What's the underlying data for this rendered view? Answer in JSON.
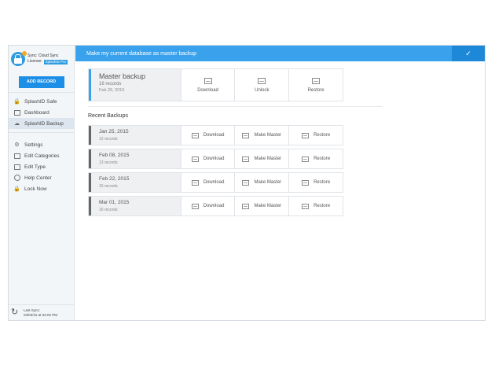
{
  "sidebar": {
    "app_name": "Sync: Cloud Sync",
    "license_label": "License:",
    "license_badge": "SplashID Pro",
    "add_record": "ADD RECORD",
    "nav_primary": [
      {
        "label": "SplashID Safe",
        "icon": "lock-icon",
        "active": false
      },
      {
        "label": "Dashboard",
        "icon": "dashboard-icon",
        "active": false
      },
      {
        "label": "SplashID Backup",
        "icon": "cloud-icon",
        "active": true
      }
    ],
    "nav_secondary": [
      {
        "label": "Settings",
        "icon": "gear-icon"
      },
      {
        "label": "Edit Categories",
        "icon": "folder-icon"
      },
      {
        "label": "Edit Type",
        "icon": "folder-icon"
      },
      {
        "label": "Help Center",
        "icon": "info-icon"
      },
      {
        "label": "Lock Now",
        "icon": "lock-icon"
      }
    ],
    "footer": {
      "last_sync_label": "Last Sync:",
      "last_sync_time": "03/02/15 at 02:02 PM"
    }
  },
  "topbar": {
    "message": "Make my current database as master backup",
    "confirm_icon": "check-icon"
  },
  "master": {
    "title": "Master backup",
    "records": "16 records",
    "date": "Feb 26, 2015",
    "actions": [
      "Download",
      "Unlock",
      "Restore"
    ]
  },
  "recent": {
    "title": "Recent Backups",
    "actions": [
      "Download",
      "Make Master",
      "Restore"
    ],
    "rows": [
      {
        "date": "Jan 25, 2015",
        "records": "12 records"
      },
      {
        "date": "Feb 08, 2015",
        "records": "13 records"
      },
      {
        "date": "Feb 22, 2015",
        "records": "16 records"
      },
      {
        "date": "Mar 01, 2015",
        "records": "16 records"
      }
    ]
  }
}
